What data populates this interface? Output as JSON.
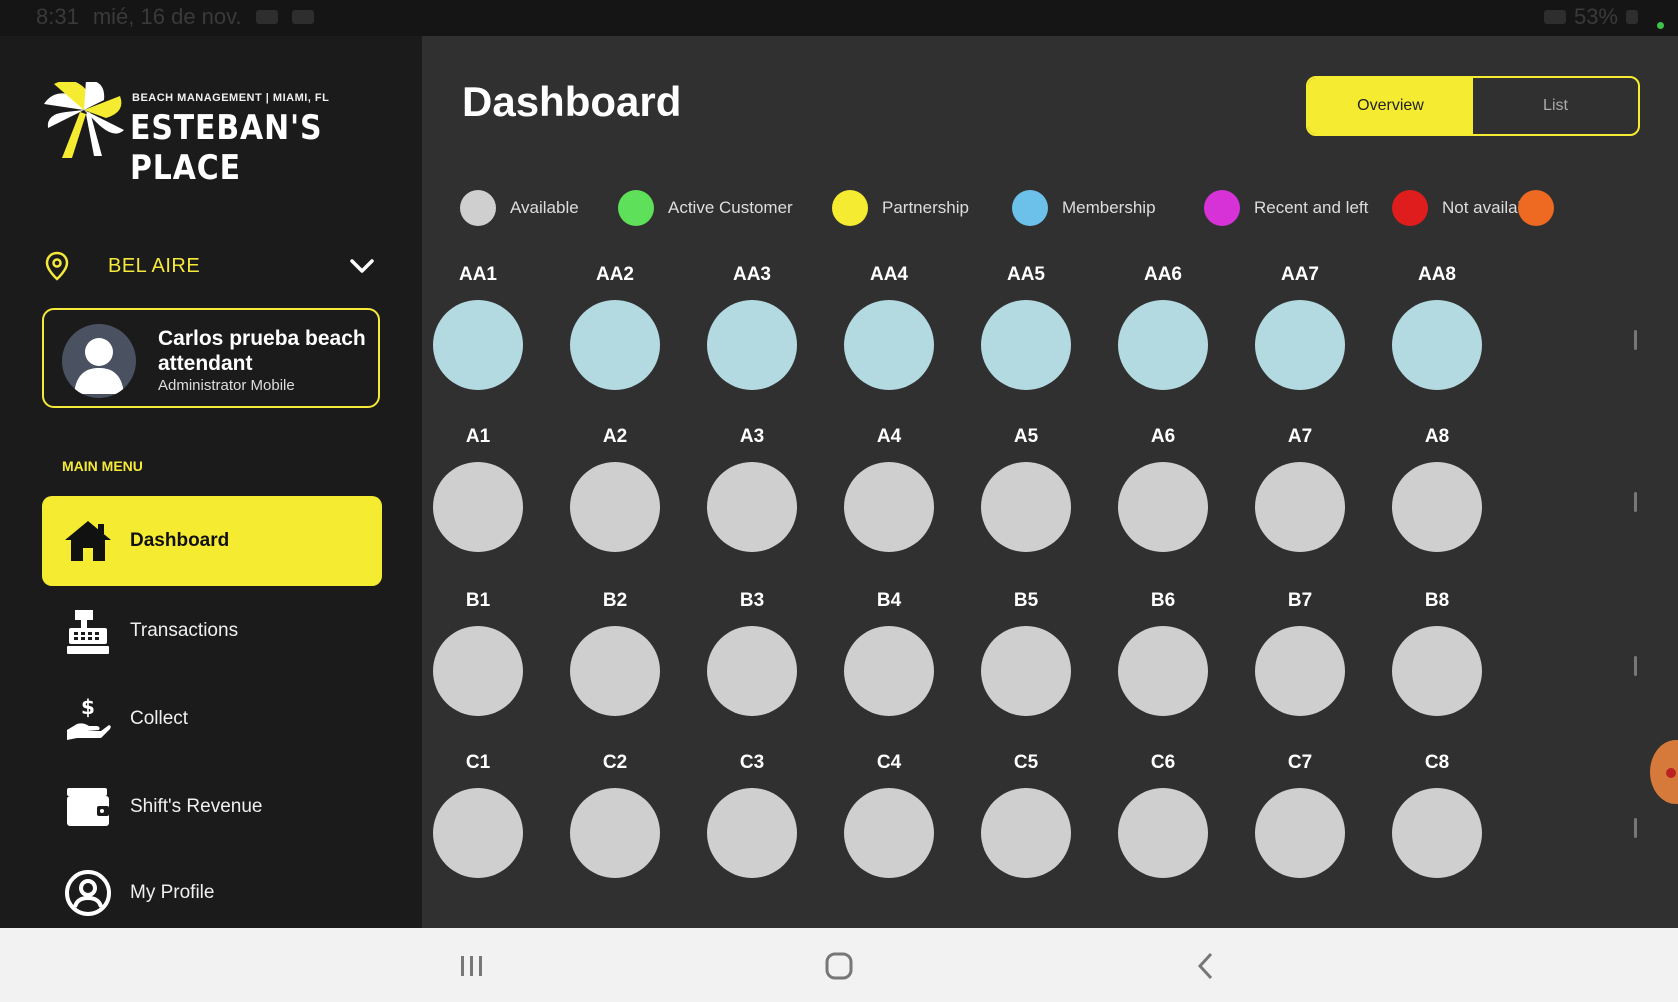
{
  "status_bar": {
    "time": "8:31",
    "date": "mié, 16 de nov.",
    "battery": "53%"
  },
  "brand": {
    "tagline": "BEACH MANAGEMENT | MIAMI, FL",
    "name": "ESTEBAN'S PLACE"
  },
  "location": {
    "name": "BEL AIRE"
  },
  "user": {
    "name": "Carlos prueba beach attendant",
    "role": "Administrator Mobile"
  },
  "menu": {
    "title": "MAIN MENU",
    "items": [
      {
        "label": "Dashboard",
        "icon": "home-icon",
        "active": true
      },
      {
        "label": "Transactions",
        "icon": "cash-register-icon"
      },
      {
        "label": "Collect",
        "icon": "hand-dollar-icon"
      },
      {
        "label": "Shift's Revenue",
        "icon": "wallet-icon"
      },
      {
        "label": "My Profile",
        "icon": "user-circle-icon"
      }
    ]
  },
  "page": {
    "title": "Dashboard"
  },
  "view_toggle": {
    "overview": "Overview",
    "list": "List",
    "selected": "Overview"
  },
  "legend": [
    {
      "label": "Available",
      "color": "#cfcfcf"
    },
    {
      "label": "Active Customer",
      "color": "#5fe05a"
    },
    {
      "label": "Partnership",
      "color": "#f5ec32"
    },
    {
      "label": "Membership",
      "color": "#6bc1ea"
    },
    {
      "label": "Recent and left",
      "color": "#d731d8"
    },
    {
      "label": "Not available",
      "color": "#e01d1d"
    },
    {
      "label": "",
      "color": "#ee6a22"
    }
  ],
  "colors": {
    "available": "#cfcfcf",
    "membership": "#b3d9e1",
    "accent": "#f5ec32"
  },
  "rows": [
    {
      "spots": [
        "AA1",
        "AA2",
        "AA3",
        "AA4",
        "AA5",
        "AA6",
        "AA7",
        "AA8"
      ],
      "status": "membership"
    },
    {
      "spots": [
        "A1",
        "A2",
        "A3",
        "A4",
        "A5",
        "A6",
        "A7",
        "A8"
      ],
      "status": "available"
    },
    {
      "spots": [
        "B1",
        "B2",
        "B3",
        "B4",
        "B5",
        "B6",
        "B7",
        "B8"
      ],
      "status": "available"
    },
    {
      "spots": [
        "C1",
        "C2",
        "C3",
        "C4",
        "C5",
        "C6",
        "C7",
        "C8"
      ],
      "status": "available"
    }
  ]
}
